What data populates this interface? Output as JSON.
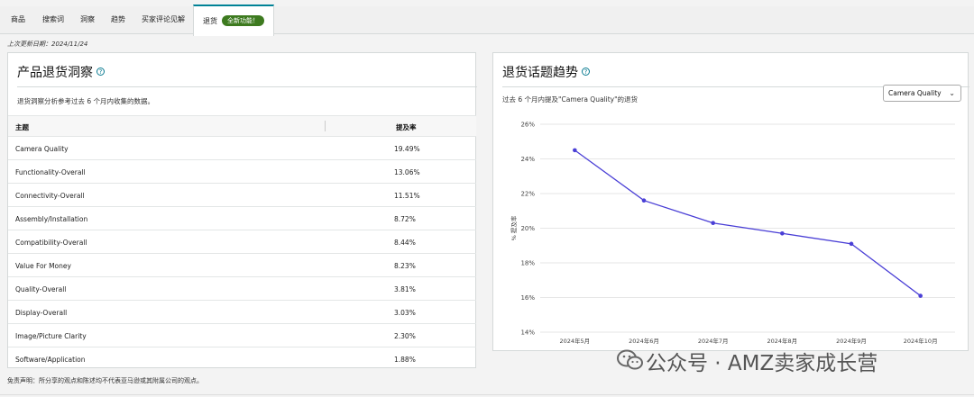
{
  "tabs": [
    {
      "label": "商品"
    },
    {
      "label": "搜索词"
    },
    {
      "label": "洞察"
    },
    {
      "label": "趋势"
    },
    {
      "label": "买家评论见解"
    },
    {
      "label": "退货",
      "badge": "全新功能！"
    }
  ],
  "last_updated": "上次更新日期：2024/11/24",
  "insights": {
    "title": "产品退货洞察",
    "help_icon": "?",
    "description": "退货洞察分析参考过去 6 个月内收集的数据。",
    "columns": [
      "主题",
      "提及率"
    ],
    "rows": [
      {
        "topic": "Camera Quality",
        "rate": "19.49%"
      },
      {
        "topic": "Functionality-Overall",
        "rate": "13.06%"
      },
      {
        "topic": "Connectivity-Overall",
        "rate": "11.51%"
      },
      {
        "topic": "Assembly/Installation",
        "rate": "8.72%"
      },
      {
        "topic": "Compatibility-Overall",
        "rate": "8.44%"
      },
      {
        "topic": "Value For Money",
        "rate": "8.23%"
      },
      {
        "topic": "Quality-Overall",
        "rate": "3.81%"
      },
      {
        "topic": "Display-Overall",
        "rate": "3.03%"
      },
      {
        "topic": "Image/Picture Clarity",
        "rate": "2.30%"
      },
      {
        "topic": "Software/Application",
        "rate": "1.88%"
      }
    ]
  },
  "trend": {
    "title": "退货话题趋势",
    "help_icon": "?",
    "description": "过去 6 个月内提及\"Camera Quality\"的退货",
    "select_value": "Camera Quality",
    "select_chevron": "⌄"
  },
  "chart_data": {
    "type": "line",
    "x": [
      "2024年5月",
      "2024年6月",
      "2024年7月",
      "2024年8月",
      "2024年9月",
      "2024年10月"
    ],
    "series": [
      {
        "values": [
          24.5,
          21.6,
          20.3,
          19.7,
          19.1,
          16.1
        ]
      }
    ],
    "ylabel": "% 提及率",
    "ylim": [
      14,
      26
    ],
    "yticks": [
      "14%",
      "16%",
      "18%",
      "20%",
      "22%",
      "24%",
      "26%"
    ],
    "grid": true,
    "color": "#4a3fd6"
  },
  "disclaimer": "免责声明：所分享的观点和陈述均不代表亚马逊或其附属公司的观点。",
  "watermark": "公众号 · AMZ卖家成长营"
}
